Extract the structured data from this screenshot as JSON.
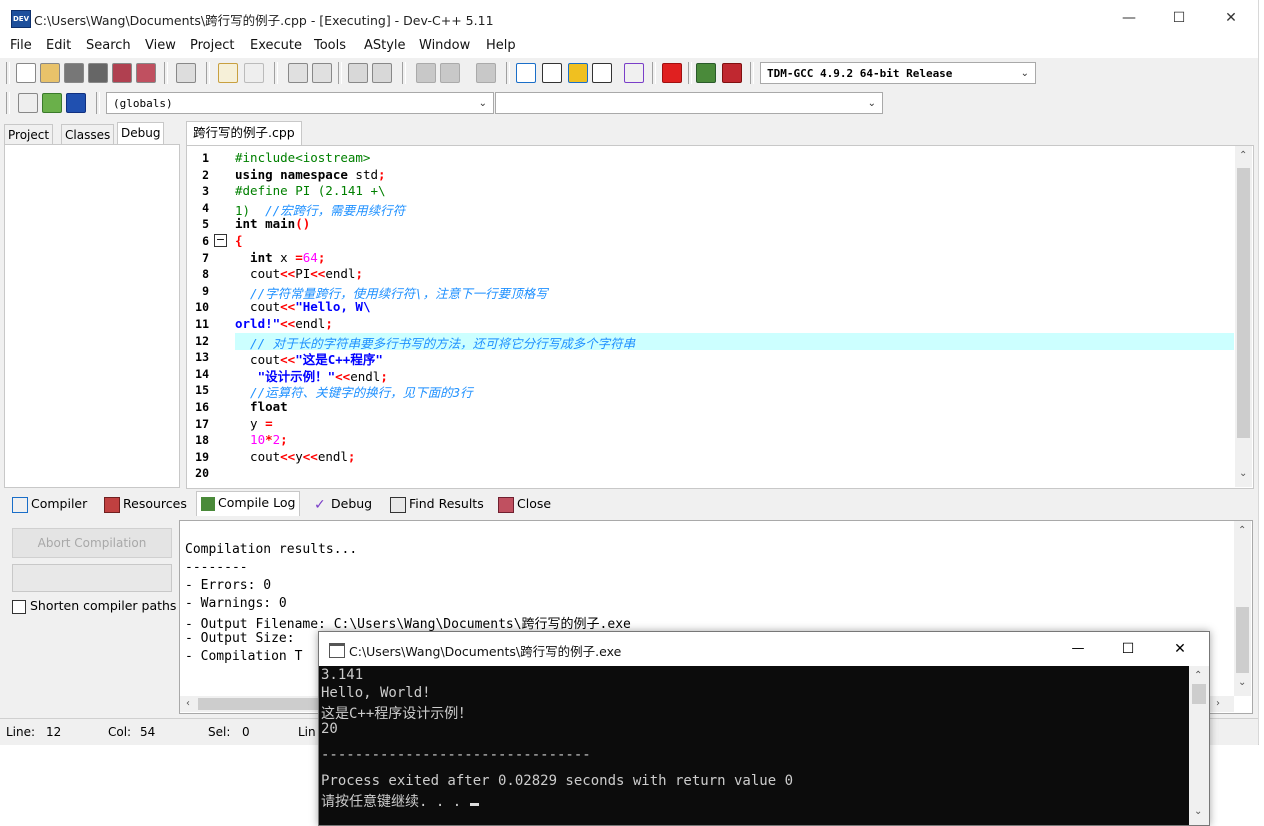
{
  "window": {
    "title": "C:\\Users\\Wang\\Documents\\跨行写的例子.cpp - [Executing] - Dev-C++ 5.11",
    "icon_text": "DEV",
    "minimize": "—",
    "maximize": "☐",
    "close": "✕"
  },
  "menu": [
    "File",
    "Edit",
    "Search",
    "View",
    "Project",
    "Execute",
    "Tools",
    "AStyle",
    "Window",
    "Help"
  ],
  "toolbar": {
    "compiler_select": "TDM-GCC 4.9.2 64-bit Release",
    "globals_select": "(globals)",
    "members_select": ""
  },
  "left_tabs": [
    "Project",
    "Classes",
    "Debug"
  ],
  "editor": {
    "tab_label": "跨行写的例子.cpp",
    "line_numbers": [
      "1",
      "2",
      "3",
      "4",
      "5",
      "6",
      "7",
      "8",
      "9",
      "10",
      "11",
      "12",
      "13",
      "14",
      "15",
      "16",
      "17",
      "18",
      "19",
      "20"
    ],
    "fold_marker": "−"
  },
  "code": {
    "l1": "#include<iostream>",
    "l2a": "using namespace",
    "l2b": " std",
    "l2c": ";",
    "l3": "#define PI (2.141 +\\",
    "l4a": "1)  ",
    "l4b": "//宏跨行，需要用续行符",
    "l5a": "int",
    "l5b": " main",
    "l5c": "()",
    "l6": "{",
    "l7a": "  int",
    "l7b": " x ",
    "l7c": "=",
    "l7d": "64",
    "l7e": ";",
    "l8a": "  cout",
    "l8b": "<<",
    "l8c": "PI",
    "l8d": "<<",
    "l8e": "endl",
    "l8f": ";",
    "l9": "  //字符常量跨行，使用续行符\\，注意下一行要顶格写",
    "l10a": "  cout",
    "l10b": "<<",
    "l10c": "\"Hello, W\\",
    "l11a": "orld!\"",
    "l11b": "<<",
    "l11c": "endl",
    "l11d": ";",
    "l12": "  // 对于长的字符串要多行书写的方法，还可将它分行写成多个字符串",
    "l13a": "  cout",
    "l13b": "<<",
    "l13c": "\"这是C++程序\"",
    "l14a": "   \"设计示例！\"",
    "l14b": "<<",
    "l14c": "endl",
    "l14d": ";",
    "l15": "  //运算符、关键字的换行，见下面的3行",
    "l16": "  float",
    "l17a": "  y ",
    "l17b": "=",
    "l18a": "  10",
    "l18b": "*",
    "l18c": "2",
    "l18d": ";",
    "l19a": "  cout",
    "l19b": "<<",
    "l19c": "y",
    "l19d": "<<",
    "l19e": "endl",
    "l19f": ";"
  },
  "bottom_tabs": [
    "Compiler",
    "Resources",
    "Compile Log",
    "Debug",
    "Find Results",
    "Close"
  ],
  "compile": {
    "abort_label": "Abort Compilation",
    "shorten_label": "Shorten compiler paths",
    "log": [
      "Compilation results...",
      "--------",
      "- Errors: 0",
      "- Warnings: 0",
      "- Output Filename: C:\\Users\\Wang\\Documents\\跨行写的例子.exe",
      "- Output Size:",
      "- Compilation T"
    ]
  },
  "status": {
    "line_label": "Line:",
    "line_value": "12",
    "col_label": "Col:",
    "col_value": "54",
    "sel_label": "Sel:",
    "sel_value": "0",
    "lines_label": "Lin"
  },
  "console": {
    "title": "C:\\Users\\Wang\\Documents\\跨行写的例子.exe",
    "output": [
      "3.141",
      "Hello, World!",
      "这是C++程序设计示例！",
      "20",
      "",
      "--------------------------------",
      "Process exited after 0.02829 seconds with return value 0",
      "请按任意键继续. . . "
    ]
  },
  "colors": {
    "highlight_line": "#ccffff",
    "comment": "#1e90ff",
    "preprocessor": "#008000",
    "string": "#0000ff",
    "number": "#ff00ff",
    "operator": "#ff0000"
  }
}
